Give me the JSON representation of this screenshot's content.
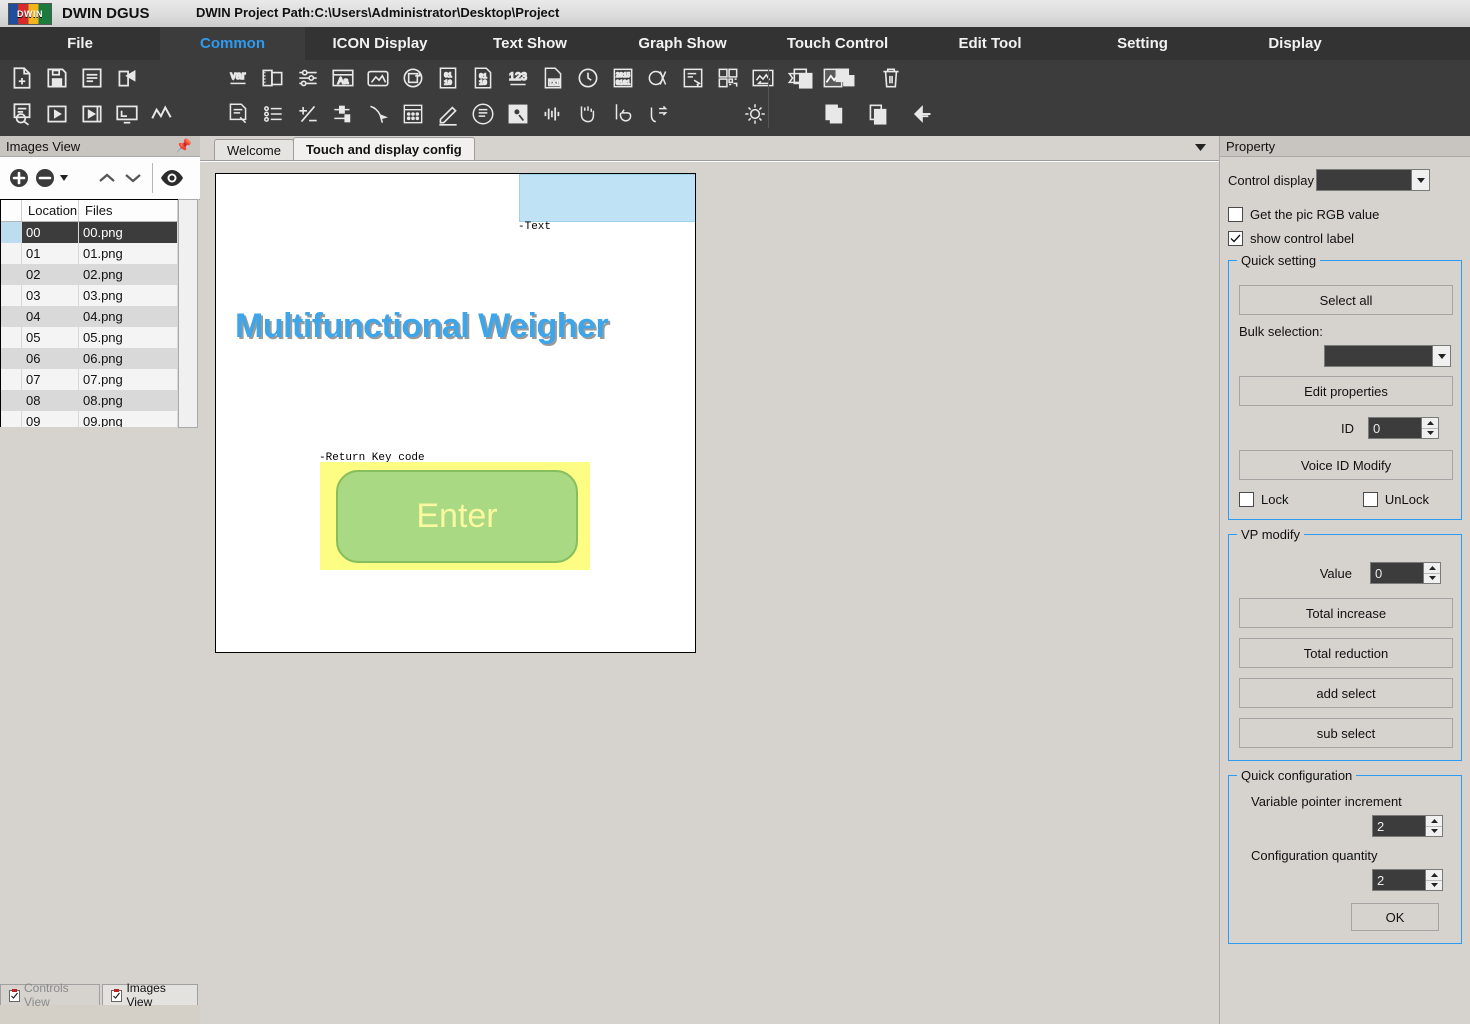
{
  "titlebar": {
    "logo_text": "DWIN",
    "app_title": "DWIN DGUS",
    "project_path": "DWIN Project Path:C:\\Users\\Administrator\\Desktop\\Project"
  },
  "menubar": {
    "items": [
      {
        "label": "File",
        "active": false
      },
      {
        "label": "Common",
        "active": true
      },
      {
        "label": "ICON Display",
        "active": false
      },
      {
        "label": "Text Show",
        "active": false
      },
      {
        "label": "Graph Show",
        "active": false
      },
      {
        "label": "Touch Control",
        "active": false
      },
      {
        "label": "Edit Tool",
        "active": false
      },
      {
        "label": "Setting",
        "active": false
      },
      {
        "label": "Display",
        "active": false
      }
    ]
  },
  "toolbar": {
    "group1_row1": [
      "new-file-icon",
      "save-icon",
      "export-page-icon",
      "share-out-icon"
    ],
    "group1_row2": [
      "file-search-icon",
      "play-icon",
      "film-play-icon",
      "monitor-preview-icon",
      "curve-icon"
    ],
    "group2_row1": [
      "var-icon",
      "frame-stack-icon",
      "sliders-icon",
      "text-box-icon",
      "image-box-icon",
      "rotate-icon",
      "binary-icon",
      "bin-data-icon",
      "number-123-icon",
      "txt-file-icon",
      "clock-icon",
      "date-icon",
      "art-icon",
      "list-touch-icon",
      "qr-code-icon",
      "image-swap-icon",
      "slider-bar-icon",
      "chart-icon"
    ],
    "group2_row2": [
      "doc-edit-icon",
      "bullet-list-icon",
      "plus-minus-icon",
      "adjust-icon",
      "touch-drag-icon",
      "keypad-icon",
      "pen-icon",
      "disc-icon",
      "hdd-icon",
      "waveform-icon",
      "gesture-icon",
      "hand-touch-icon",
      "swipe-icon"
    ],
    "group3_row1": [
      "copy-icon",
      "duplicate-icon",
      "delete-icon"
    ],
    "group3_row2": [
      "brightness-icon",
      "copy-multi-icon",
      "paste-icon",
      "undo-icon"
    ]
  },
  "left_panel": {
    "title": "Images View",
    "toolbar": [
      "add-image-icon",
      "remove-image-icon",
      "dropdown-caret-icon",
      "move-up-icon",
      "move-down-icon",
      "preview-eye-icon"
    ],
    "columns": [
      "Location",
      "Files"
    ],
    "rows": [
      {
        "location": "00",
        "file": "00.png",
        "selected": true
      },
      {
        "location": "01",
        "file": "01.png",
        "selected": false
      },
      {
        "location": "02",
        "file": "02.png",
        "selected": false
      },
      {
        "location": "03",
        "file": "03.png",
        "selected": false
      },
      {
        "location": "04",
        "file": "04.png",
        "selected": false
      },
      {
        "location": "05",
        "file": "05.png",
        "selected": false
      },
      {
        "location": "06",
        "file": "06.png",
        "selected": false
      },
      {
        "location": "07",
        "file": "07.png",
        "selected": false
      },
      {
        "location": "08",
        "file": "08.png",
        "selected": false
      },
      {
        "location": "09",
        "file": "09.png",
        "selected": false
      }
    ],
    "bottom_tabs": [
      {
        "label": "Controls View",
        "active": false
      },
      {
        "label": "Images View",
        "active": true
      }
    ]
  },
  "center": {
    "tabs": [
      {
        "label": "Welcome",
        "active": false
      },
      {
        "label": "Touch and display config",
        "active": true
      }
    ],
    "canvas": {
      "text_control_label": "-Text",
      "title_text": "Multifunctional Weigher",
      "button_control_label": "-Return Key code",
      "button_text": "Enter"
    }
  },
  "right_panel": {
    "title": "Property",
    "control_display_label": "Control display",
    "control_display_value": "",
    "get_pic_rgb_label": "Get the pic RGB value",
    "get_pic_rgb_checked": false,
    "show_control_label_label": "show control label",
    "show_control_label_checked": true,
    "quick_setting": {
      "caption": "Quick setting",
      "select_all": "Select all",
      "bulk_selection_label": "Bulk selection:",
      "bulk_selection_value": "",
      "edit_properties": "Edit properties",
      "id_label": "ID",
      "id_value": "0",
      "voice_id_modify": "Voice ID Modify",
      "lock_label": "Lock",
      "lock_checked": false,
      "unlock_label": "UnLock",
      "unlock_checked": false
    },
    "vp_modify": {
      "caption": "VP modify",
      "value_label": "Value",
      "value": "0",
      "total_increase": "Total increase",
      "total_reduction": "Total reduction",
      "add_select": "add select",
      "sub_select": "sub select"
    },
    "quick_configuration": {
      "caption": "Quick configuration",
      "variable_pointer_increment_label": "Variable pointer increment",
      "variable_pointer_increment_value": "2",
      "configuration_quantity_label": "Configuration quantity",
      "configuration_quantity_value": "2",
      "ok": "OK"
    }
  },
  "colors": {
    "accent_blue": "#2e9bf0",
    "menu_bg": "#333333",
    "toolbar_bg": "#3c3c3c",
    "panel_bg": "#d6d3ce",
    "title_blue": "#3da5ea",
    "button_green": "#a9d982",
    "highlight_yellow": "#fdfd83",
    "textbox_blue": "#bfe3f4"
  }
}
